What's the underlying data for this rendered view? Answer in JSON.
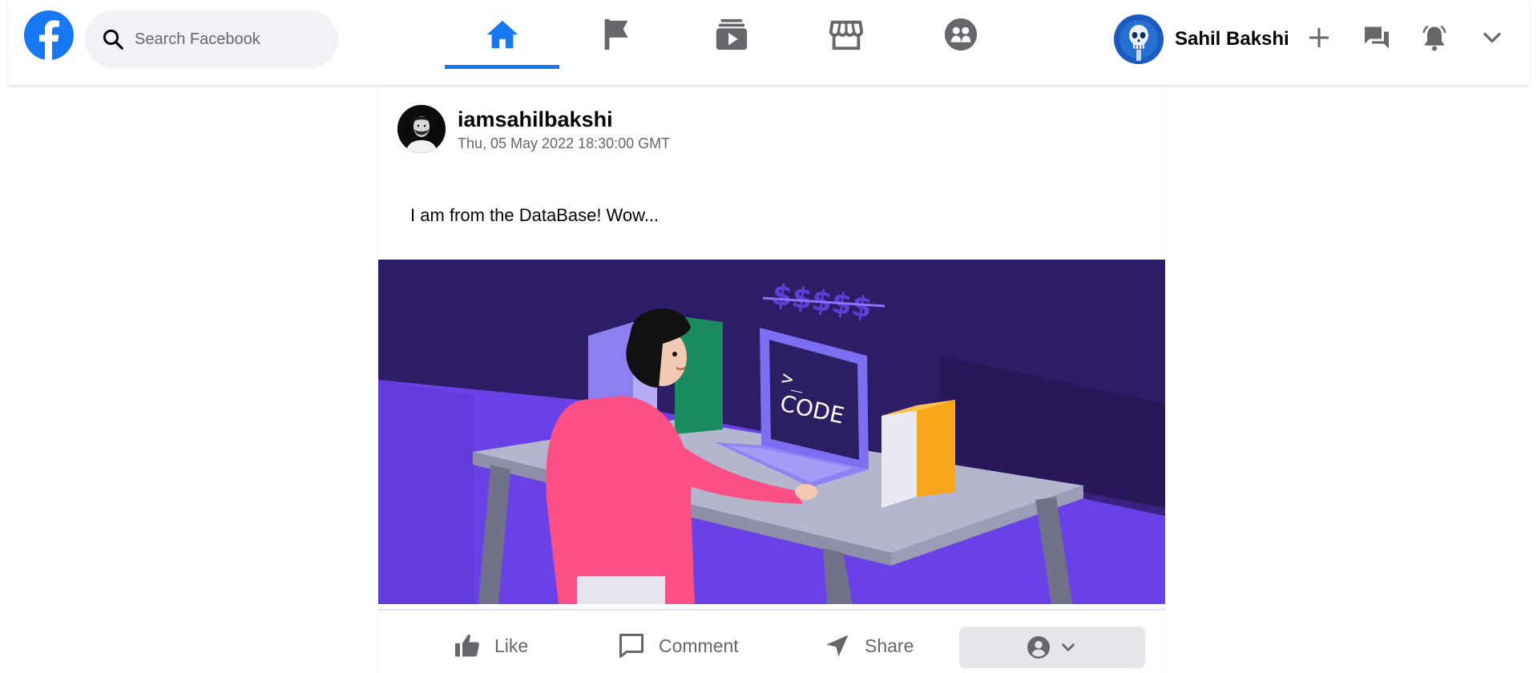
{
  "header": {
    "search_placeholder": "Search Facebook",
    "profile_name": "Sahil Bakshi",
    "accent_color": "#1877f2",
    "nav_tabs": [
      {
        "name": "home",
        "icon": "home-icon",
        "active": true
      },
      {
        "name": "pages",
        "icon": "flag-icon",
        "active": false
      },
      {
        "name": "watch",
        "icon": "video-icon",
        "active": false
      },
      {
        "name": "marketplace",
        "icon": "store-icon",
        "active": false
      },
      {
        "name": "groups",
        "icon": "groups-icon",
        "active": false
      }
    ],
    "buttons": [
      "plus-icon",
      "messenger-icon",
      "bell-icon",
      "chevron-down-icon"
    ]
  },
  "post": {
    "username": "iamsahilbakshi",
    "timestamp": "Thu, 05 May 2022 18:30:00 GMT",
    "text": "I am from the DataBase! Wow...",
    "image": {
      "laptop_text": "CODE",
      "prompt_text": ">_",
      "currency_text": "$$$$$"
    },
    "actions": {
      "like_label": "Like",
      "comment_label": "Comment",
      "share_label": "Share"
    }
  }
}
